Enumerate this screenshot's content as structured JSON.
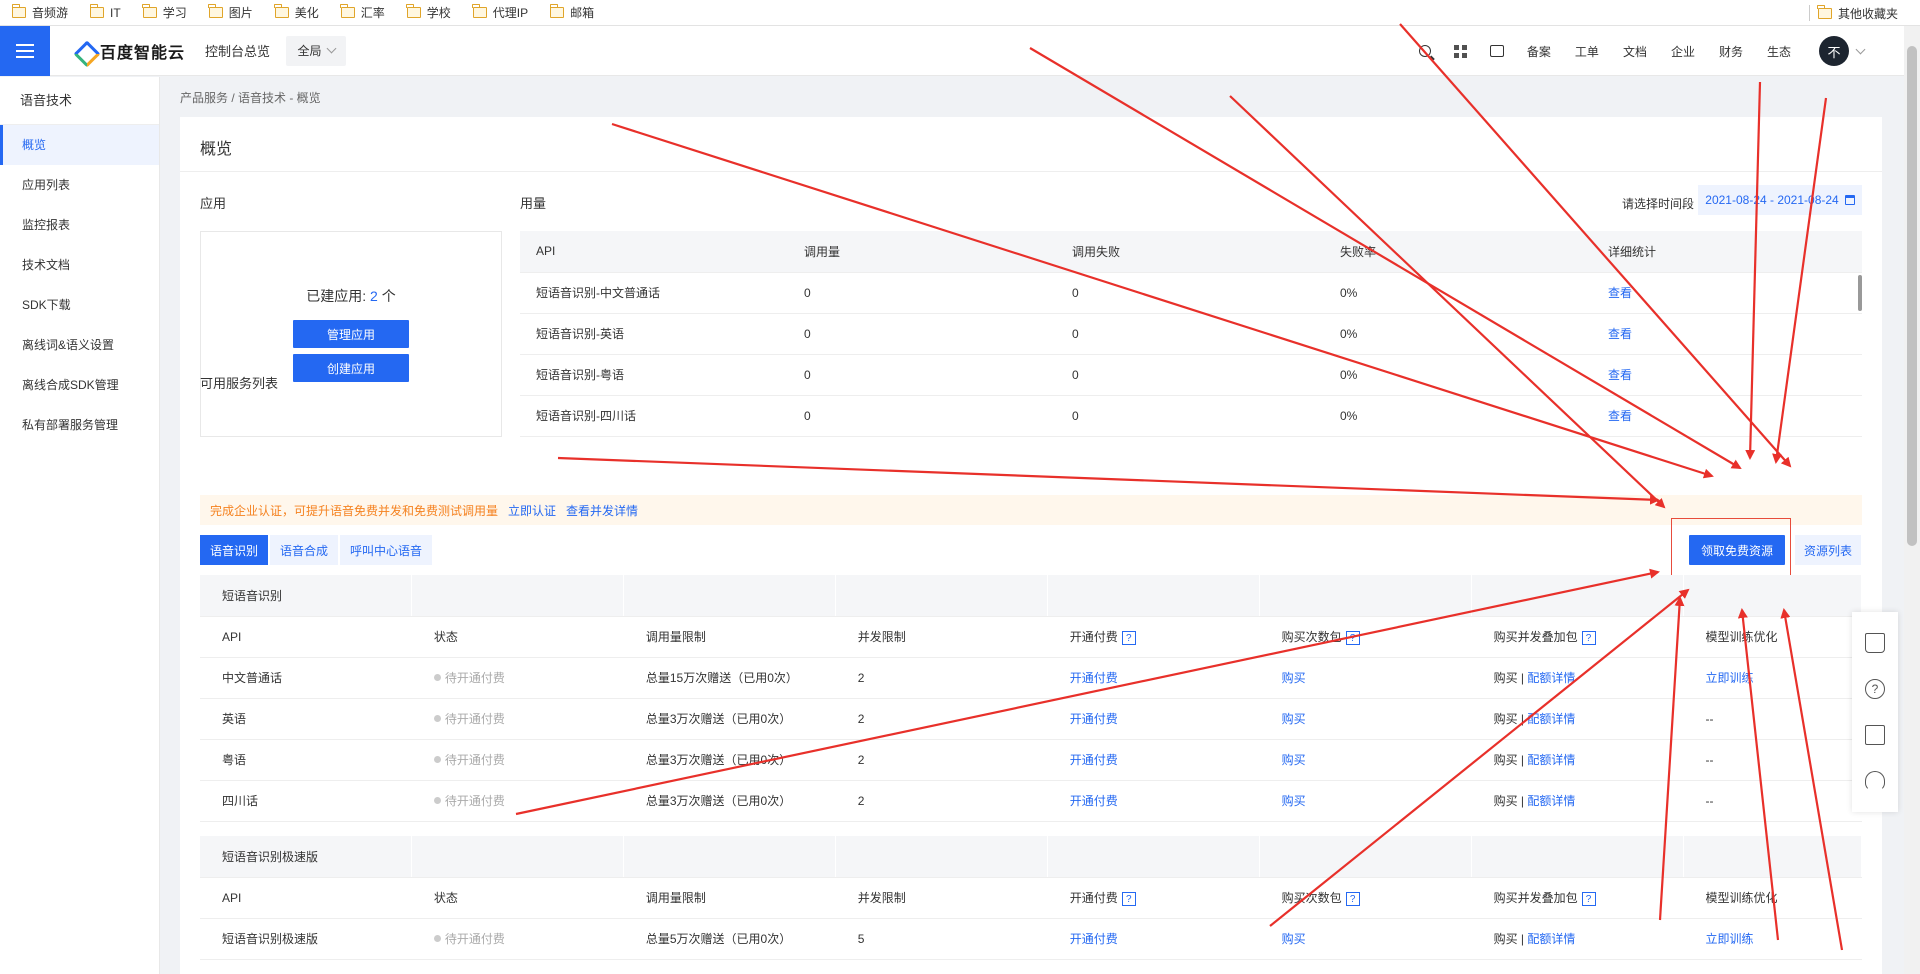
{
  "bookmarks": [
    "音频游",
    "IT",
    "学习",
    "图片",
    "美化",
    "汇率",
    "学校",
    "代理IP",
    "邮箱"
  ],
  "bookmarks_other": "其他收藏夹",
  "topbar": {
    "brand": "百度智能云",
    "console": "控制台总览",
    "region": "全局",
    "nav": [
      "备案",
      "工单",
      "文档",
      "企业",
      "财务",
      "生态"
    ],
    "avatar": "不"
  },
  "sidebar": {
    "title": "语音技术",
    "items": [
      "概览",
      "应用列表",
      "监控报表",
      "技术文档",
      "SDK下载",
      "离线词&语义设置",
      "离线合成SDK管理",
      "私有部署服务管理"
    ]
  },
  "breadcrumb": "产品服务 / 语音技术 - 概览",
  "overview": {
    "title": "概览",
    "app_section": "应用",
    "usage_section": "用量",
    "app_count_prefix": "已建应用:",
    "app_count": "2",
    "app_count_suffix": "个",
    "manage_app": "管理应用",
    "create_app": "创建应用",
    "date_label": "请选择时间段",
    "date_range": "2021-08-24 - 2021-08-24"
  },
  "usage_table": {
    "headers": [
      "API",
      "调用量",
      "调用失败",
      "失败率",
      "详细统计"
    ],
    "rows": [
      [
        "短语音识别-中文普通话",
        "0",
        "0",
        "0%",
        "查看"
      ],
      [
        "短语音识别-英语",
        "0",
        "0",
        "0%",
        "查看"
      ],
      [
        "短语音识别-粤语",
        "0",
        "0",
        "0%",
        "查看"
      ],
      [
        "短语音识别-四川话",
        "0",
        "0",
        "0%",
        "查看"
      ]
    ]
  },
  "services": {
    "title": "可用服务列表",
    "notice": "完成企业认证，可提升语音免费并发和免费测试调用量",
    "notice_link1": "立即认证",
    "notice_link2": "查看并发详情",
    "tabs": [
      "语音识别",
      "语音合成",
      "呼叫中心语音"
    ],
    "free_btn": "领取免费资源",
    "res_btn": "资源列表",
    "headers": [
      "API",
      "状态",
      "调用量限制",
      "并发限制",
      "开通付费",
      "购买次数包",
      "购买并发叠加包",
      "模型训练优化"
    ],
    "group1": {
      "name": "短语音识别",
      "rows": [
        [
          "中文普通话",
          "待开通付费",
          "总量15万次赠送（已用0次）",
          "2",
          "开通付费",
          "购买",
          "购买",
          "配额详情",
          "立即训练"
        ],
        [
          "英语",
          "待开通付费",
          "总量3万次赠送（已用0次）",
          "2",
          "开通付费",
          "购买",
          "购买",
          "配额详情",
          "--"
        ],
        [
          "粤语",
          "待开通付费",
          "总量3万次赠送（已用0次）",
          "2",
          "开通付费",
          "购买",
          "购买",
          "配额详情",
          "--"
        ],
        [
          "四川话",
          "待开通付费",
          "总量3万次赠送（已用0次）",
          "2",
          "开通付费",
          "购买",
          "购买",
          "配额详情",
          "--"
        ]
      ]
    },
    "group2": {
      "name": "短语音识别极速版",
      "rows": [
        [
          "短语音识别极速版",
          "待开通付费",
          "总量5万次赠送（已用0次）",
          "5",
          "开通付费",
          "购买",
          "购买",
          "配额详情",
          "立即训练"
        ]
      ]
    }
  },
  "colors": {
    "brand": "#2468f2",
    "notice": "#f58220",
    "annotation": "#e74c3c"
  }
}
